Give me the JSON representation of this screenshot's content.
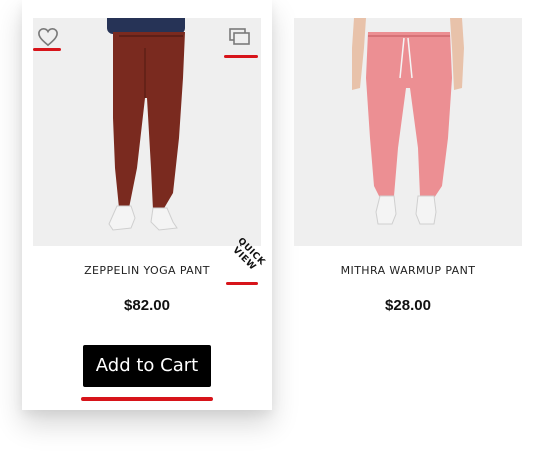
{
  "products": [
    {
      "title": "ZEPPELIN YOGA PANT",
      "price": "$82.00",
      "button_label": "Add to Cart",
      "quick_view_line1": "QUICK",
      "quick_view_line2": "VIEW",
      "pants_color": "#7a2a1f",
      "icons": [
        "heart-icon",
        "windows-icon"
      ]
    },
    {
      "title": "MITHRA WARMUP PANT",
      "price": "$28.00",
      "pants_color": "#ec8f93"
    }
  ],
  "colors": {
    "highlight": "#d7141a",
    "button_bg": "#000000",
    "image_bg": "#efefef"
  }
}
